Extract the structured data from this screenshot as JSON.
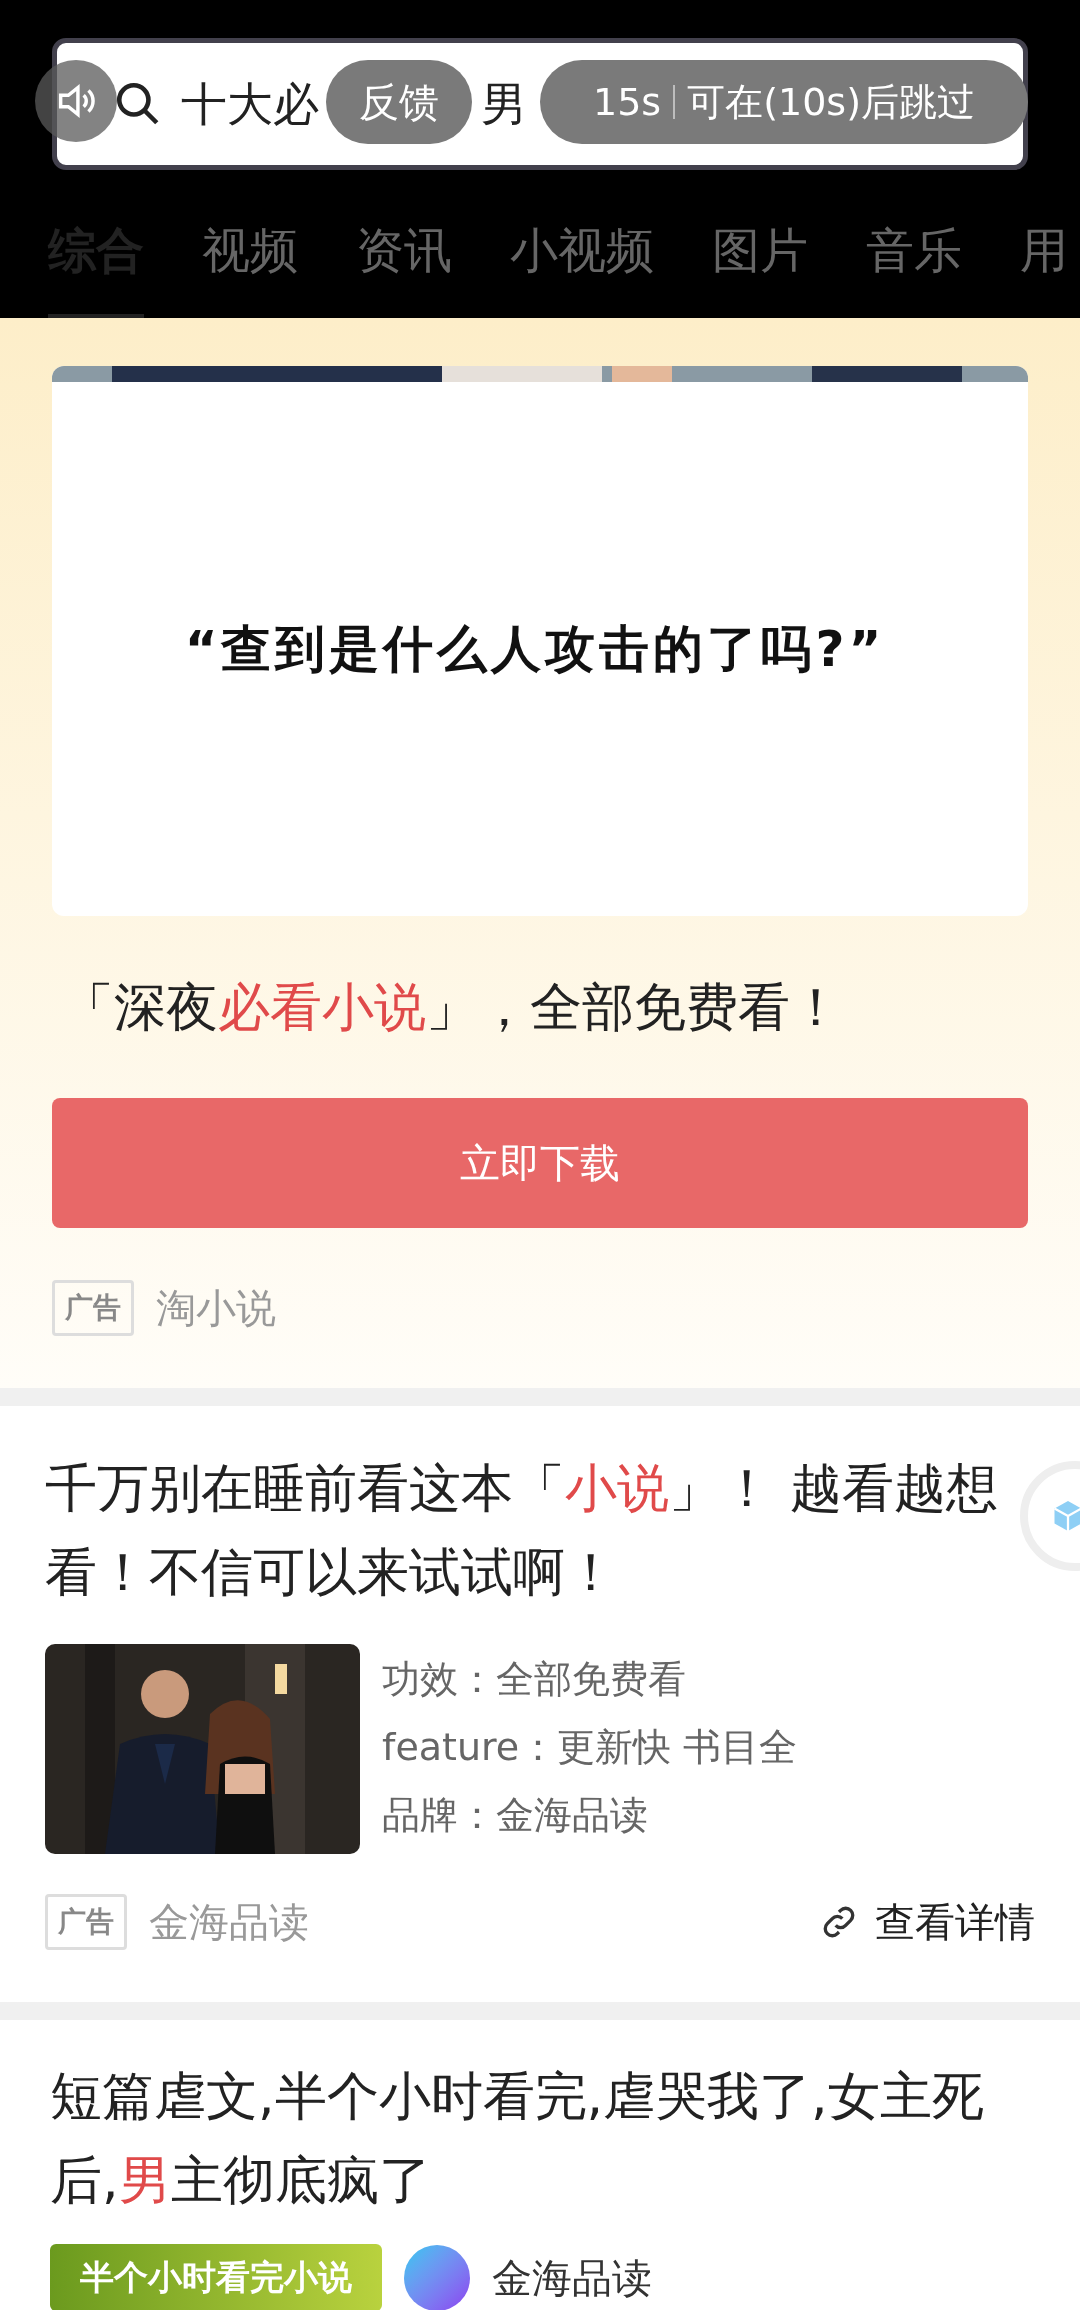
{
  "search": {
    "visible_parts": [
      "十大必",
      "男"
    ]
  },
  "ad_overlay": {
    "feedback": "反馈",
    "countdown": "15s",
    "skip": "可在(10s)后跳过"
  },
  "tabs": [
    {
      "label": "综合",
      "selected": true
    },
    {
      "label": "视频",
      "selected": false
    },
    {
      "label": "资讯",
      "selected": false
    },
    {
      "label": "小视频",
      "selected": false
    },
    {
      "label": "图片",
      "selected": false
    },
    {
      "label": "音乐",
      "selected": false
    },
    {
      "label": "用",
      "selected": false
    }
  ],
  "ad_card": {
    "image_caption": "“查到是什么人攻击的了吗?”",
    "headline": [
      {
        "text": "「深夜",
        "highlight": false
      },
      {
        "text": "必看小说",
        "highlight": true
      },
      {
        "text": "」，全部免费看！",
        "highlight": false
      }
    ],
    "button": "立即下载",
    "tag": "广告",
    "source": "淘小说"
  },
  "ad_card_2": {
    "title": [
      {
        "text": "千万别在睡前看这本「",
        "highlight": false
      },
      {
        "text": "小说",
        "highlight": true
      },
      {
        "text": "」！ 越看越想看！不信可以来试试啊！",
        "highlight": false
      }
    ],
    "features": [
      "功效：全部免费看",
      "feature：更新快 书目全",
      "品牌：金海品读"
    ],
    "tag": "广告",
    "source": "金海品读",
    "link": "查看详情"
  },
  "article": {
    "title": [
      {
        "text": "短篇虐文,半个小时看完,虐哭我了,女主死后,",
        "highlight": false
      },
      {
        "text": "男",
        "highlight": true
      },
      {
        "text": "主彻底疯了",
        "highlight": false
      }
    ],
    "badge": "半个小时看完小说",
    "source": "金海品读"
  }
}
